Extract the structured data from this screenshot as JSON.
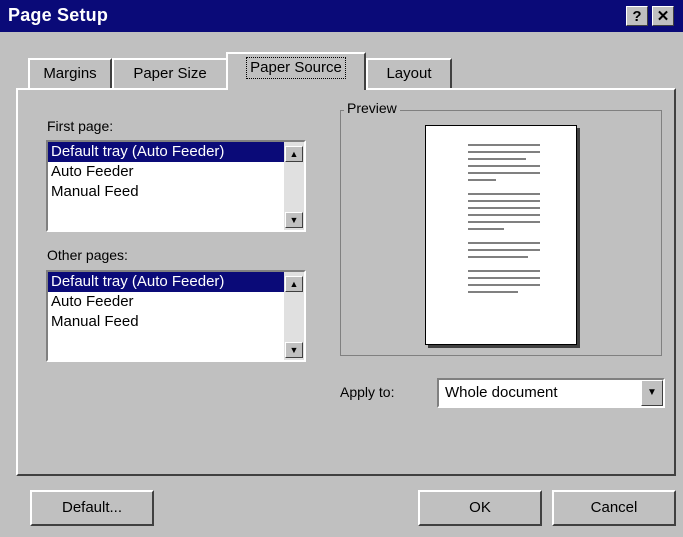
{
  "window": {
    "title": "Page Setup",
    "help_label": "?",
    "close_label": "✕"
  },
  "tabs": [
    {
      "label": "Margins"
    },
    {
      "label": "Paper Size"
    },
    {
      "label": "Paper Source"
    },
    {
      "label": "Layout"
    }
  ],
  "first_page": {
    "label": "First page:",
    "items": [
      "Default tray (Auto Feeder)",
      "Auto Feeder",
      "Manual Feed"
    ],
    "selected": "Default tray (Auto Feeder)"
  },
  "other_pages": {
    "label": "Other pages:",
    "items": [
      "Default tray (Auto Feeder)",
      "Auto Feeder",
      "Manual Feed"
    ],
    "selected": "Default tray (Auto Feeder)"
  },
  "preview": {
    "label": "Preview"
  },
  "apply_to": {
    "label": "Apply to:",
    "value": "Whole document"
  },
  "buttons": {
    "default": "Default...",
    "ok": "OK",
    "cancel": "Cancel"
  },
  "icons": {
    "scroll_up": "scroll-up-arrow",
    "scroll_down": "scroll-down-arrow",
    "dropdown": "dropdown-arrow"
  },
  "colors": {
    "titlebar": "#0a0a78",
    "selection": "#0a0a78",
    "face": "#c0c0c0"
  }
}
